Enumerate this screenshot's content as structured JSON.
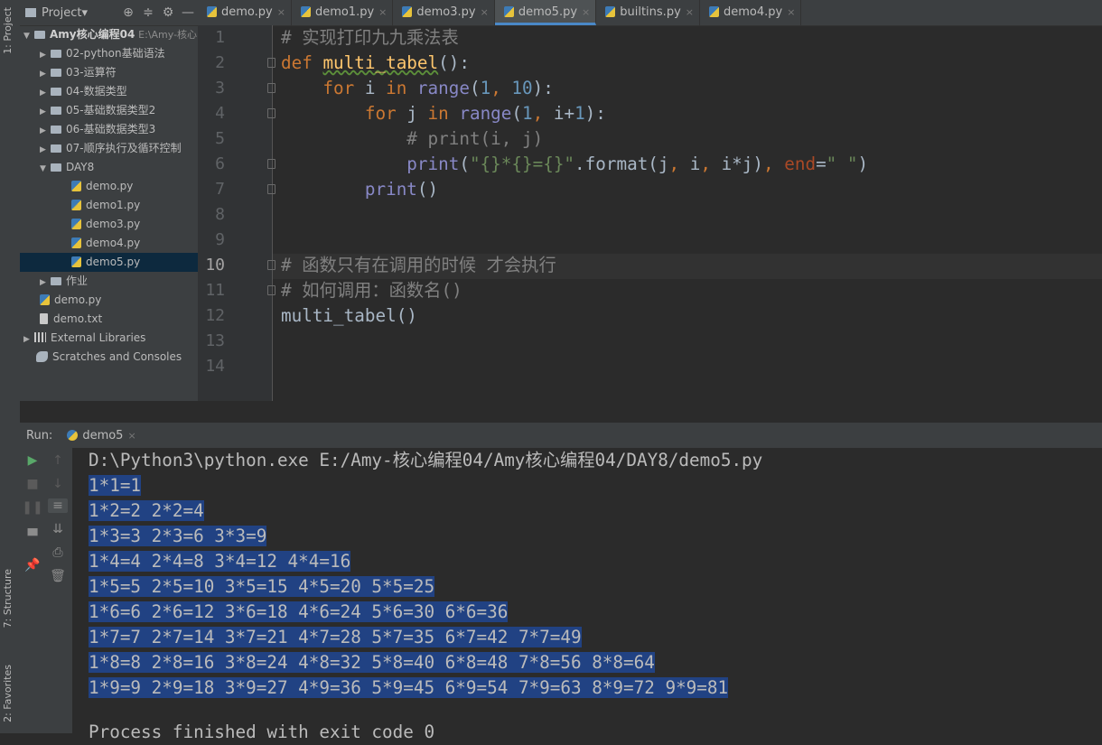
{
  "side_tabs": {
    "project": "1: Project",
    "structure": "7: Structure",
    "favorites": "2: Favorites"
  },
  "project_panel": {
    "title": "Project▾",
    "root": {
      "name": "Amy核心编程04",
      "path": "E:\\Amy-核心"
    },
    "items": [
      {
        "label": "02-python基础语法",
        "type": "folder",
        "depth": 1,
        "expanded": false
      },
      {
        "label": "03-运算符",
        "type": "folder",
        "depth": 1,
        "expanded": false
      },
      {
        "label": "04-数据类型",
        "type": "folder",
        "depth": 1,
        "expanded": false
      },
      {
        "label": "05-基础数据类型2",
        "type": "folder",
        "depth": 1,
        "expanded": false
      },
      {
        "label": "06-基础数据类型3",
        "type": "folder",
        "depth": 1,
        "expanded": false
      },
      {
        "label": "07-顺序执行及循环控制",
        "type": "folder",
        "depth": 1,
        "expanded": false
      },
      {
        "label": "DAY8",
        "type": "folder",
        "depth": 1,
        "expanded": true
      },
      {
        "label": "demo.py",
        "type": "py",
        "depth": 2
      },
      {
        "label": "demo1.py",
        "type": "py",
        "depth": 2
      },
      {
        "label": "demo3.py",
        "type": "py",
        "depth": 2
      },
      {
        "label": "demo4.py",
        "type": "py",
        "depth": 2
      },
      {
        "label": "demo5.py",
        "type": "py",
        "depth": 2,
        "selected": true
      },
      {
        "label": "作业",
        "type": "folder",
        "depth": 1,
        "expanded": false
      },
      {
        "label": "demo.py",
        "type": "py",
        "depth": 1
      },
      {
        "label": "demo.txt",
        "type": "txt",
        "depth": 1
      },
      {
        "label": "External Libraries",
        "type": "lib",
        "depth": 0,
        "expanded": false
      },
      {
        "label": "Scratches and Consoles",
        "type": "scratch",
        "depth": 0
      }
    ]
  },
  "tabs": [
    {
      "label": "demo.py",
      "active": false
    },
    {
      "label": "demo1.py",
      "active": false
    },
    {
      "label": "demo3.py",
      "active": false
    },
    {
      "label": "demo5.py",
      "active": true
    },
    {
      "label": "builtins.py",
      "active": false
    },
    {
      "label": "demo4.py",
      "active": false
    }
  ],
  "editor": {
    "current_line": 10,
    "line_numbers": [
      "1",
      "2",
      "3",
      "4",
      "5",
      "6",
      "7",
      "8",
      "9",
      "10",
      "11",
      "12",
      "13",
      "14"
    ],
    "lines": [
      [
        {
          "t": "# 实现打印九九乘法表",
          "c": "cmt"
        }
      ],
      [
        {
          "t": "def ",
          "c": "kw"
        },
        {
          "t": "multi_tabel",
          "c": "fn squig"
        },
        {
          "t": "():",
          "c": ""
        }
      ],
      [
        {
          "t": "    for ",
          "c": "kw"
        },
        {
          "t": "i ",
          "c": ""
        },
        {
          "t": "in ",
          "c": "kw"
        },
        {
          "t": "range",
          "c": "bi"
        },
        {
          "t": "(",
          "c": ""
        },
        {
          "t": "1",
          "c": "num"
        },
        {
          "t": ", ",
          "c": "kw"
        },
        {
          "t": "10",
          "c": "num"
        },
        {
          "t": "):",
          "c": ""
        }
      ],
      [
        {
          "t": "        for ",
          "c": "kw"
        },
        {
          "t": "j ",
          "c": ""
        },
        {
          "t": "in ",
          "c": "kw"
        },
        {
          "t": "range",
          "c": "bi"
        },
        {
          "t": "(",
          "c": ""
        },
        {
          "t": "1",
          "c": "num"
        },
        {
          "t": ", ",
          "c": "kw"
        },
        {
          "t": "i+",
          "c": ""
        },
        {
          "t": "1",
          "c": "num"
        },
        {
          "t": "):",
          "c": ""
        }
      ],
      [
        {
          "t": "            # print(i, j)",
          "c": "cmt"
        }
      ],
      [
        {
          "t": "            print",
          "c": "bi"
        },
        {
          "t": "(",
          "c": ""
        },
        {
          "t": "\"{}*{}={}\"",
          "c": "str"
        },
        {
          "t": ".format(j",
          "c": ""
        },
        {
          "t": ", ",
          "c": "kw"
        },
        {
          "t": "i",
          "c": ""
        },
        {
          "t": ", ",
          "c": "kw"
        },
        {
          "t": "i*j)",
          "c": ""
        },
        {
          "t": ", ",
          "c": "kw"
        },
        {
          "t": "end",
          "c": "par"
        },
        {
          "t": "=",
          "c": ""
        },
        {
          "t": "\" \"",
          "c": "str"
        },
        {
          "t": ")",
          "c": ""
        }
      ],
      [
        {
          "t": "        print",
          "c": "bi"
        },
        {
          "t": "()",
          "c": ""
        }
      ],
      [],
      [],
      [
        {
          "t": "# 函数只有在调用的时候 才会执行",
          "c": "cmt"
        }
      ],
      [
        {
          "t": "# 如何调用：函数名()",
          "c": "cmt"
        }
      ],
      [
        {
          "t": "multi_tabel()",
          "c": ""
        }
      ],
      [],
      []
    ]
  },
  "run_panel": {
    "label": "Run:",
    "config": "demo5",
    "command": "D:\\Python3\\python.exe E:/Amy-核心编程04/Amy核心编程04/DAY8/demo5.py",
    "output": [
      "1*1=1",
      "1*2=2 2*2=4",
      "1*3=3 2*3=6 3*3=9",
      "1*4=4 2*4=8 3*4=12 4*4=16",
      "1*5=5 2*5=10 3*5=15 4*5=20 5*5=25",
      "1*6=6 2*6=12 3*6=18 4*6=24 5*6=30 6*6=36",
      "1*7=7 2*7=14 3*7=21 4*7=28 5*7=35 6*7=42 7*7=49",
      "1*8=8 2*8=16 3*8=24 4*8=32 5*8=40 6*8=48 7*8=56 8*8=64",
      "1*9=9 2*9=18 3*9=27 4*9=36 5*9=45 6*9=54 7*9=63 8*9=72 9*9=81"
    ],
    "tail_line": "Process finished with exit code 0"
  }
}
